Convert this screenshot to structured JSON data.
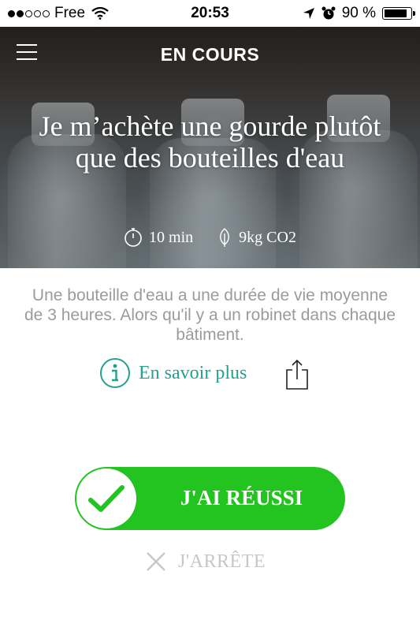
{
  "status_bar": {
    "carrier": "Free",
    "time": "20:53",
    "battery": "90 %",
    "battery_level": 0.9,
    "signal_bars_filled": 2,
    "signal_bars_total": 5
  },
  "nav": {
    "title": "EN COURS",
    "menu_icon": "hamburger-menu-icon"
  },
  "hero": {
    "title": "Je m’achète une gourde plutôt que des bouteilles d'eau",
    "duration": "10 min",
    "co2": "9kg CO2",
    "duration_icon": "stopwatch-icon",
    "co2_icon": "leaf-icon"
  },
  "content": {
    "description": "Une bouteille d'eau a une durée de vie moyenne de 3 heures. Alors qu'il y a un robinet dans chaque bâtiment.",
    "learn_more": "En savoir plus",
    "learn_more_icon": "info-icon",
    "share_icon": "share-icon"
  },
  "actions": {
    "success_label": "J'AI RÉUSSI",
    "stop_label": "J'ARRÊTE",
    "success_color": "#23c420",
    "accent_color": "#21a291"
  }
}
